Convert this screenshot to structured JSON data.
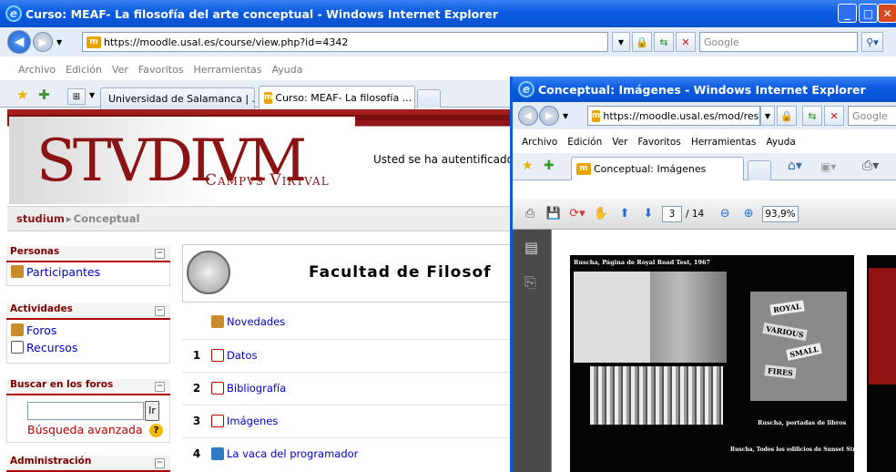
{
  "main_window": {
    "title": "Curso: MEAF- La filosofía del arte conceptual - Windows Internet Explorer",
    "url": "https://moodle.usal.es/course/view.php?id=4342",
    "search_placeholder": "Google",
    "menu": [
      "Archivo",
      "Edición",
      "Ver",
      "Favoritos",
      "Herramientas",
      "Ayuda"
    ],
    "tabs": [
      {
        "label": "Universidad de Salamanca | ..."
      },
      {
        "label": "Curso: MEAF- La filosofía ..."
      }
    ],
    "tab_close": "✕"
  },
  "moodle": {
    "logo_text": "STVDIVM",
    "logo_sub": "Campvs Virtval",
    "login_text": "Usted se ha autentificado",
    "breadcrumb_home": "studium",
    "breadcrumb_sep": "▸",
    "breadcrumb_current": "Conceptual",
    "blocks": {
      "personas": {
        "title": "Personas",
        "items": [
          "Participantes"
        ]
      },
      "actividades": {
        "title": "Actividades",
        "items": [
          "Foros",
          "Recursos"
        ]
      },
      "buscar": {
        "title": "Buscar en los foros",
        "button": "Ir",
        "advanced": "Búsqueda avanzada",
        "help": "?"
      },
      "admin": {
        "title": "Administración"
      }
    },
    "faculty_title": "Facultad de Filosof",
    "news": "Novedades",
    "sections": [
      {
        "num": "1",
        "label": "Datos"
      },
      {
        "num": "2",
        "label": "Bibliografía"
      },
      {
        "num": "3",
        "label": "Imágenes"
      },
      {
        "num": "4",
        "label": "La vaca del programador"
      }
    ]
  },
  "popup_window": {
    "title": "Conceptual: Imágenes - Windows Internet Explorer",
    "url": "https://moodle.usal.es/mod/resour",
    "search_placeholder": "Google",
    "menu": [
      "Archivo",
      "Edición",
      "Ver",
      "Favoritos",
      "Herramientas",
      "Ayuda"
    ],
    "tab_label": "Conceptual: Imágenes",
    "pdf": {
      "page": "3",
      "total": "/ 14",
      "zoom": "93,9%"
    },
    "slide_captions": {
      "top": "Ruscha, Página de Royal Road Test, 1967",
      "right": "Ruscha, portadas de libros",
      "bottom": "Ruscha, Todos los edificios de Sunset Strip"
    },
    "book_cover_texts": [
      "ROYAL",
      "VARIOUS",
      "SMALL",
      "FIRES"
    ]
  },
  "colors": {
    "xp_blue": "#0a5be0",
    "moodle_red": "#b30000",
    "link": "#0000cc"
  }
}
